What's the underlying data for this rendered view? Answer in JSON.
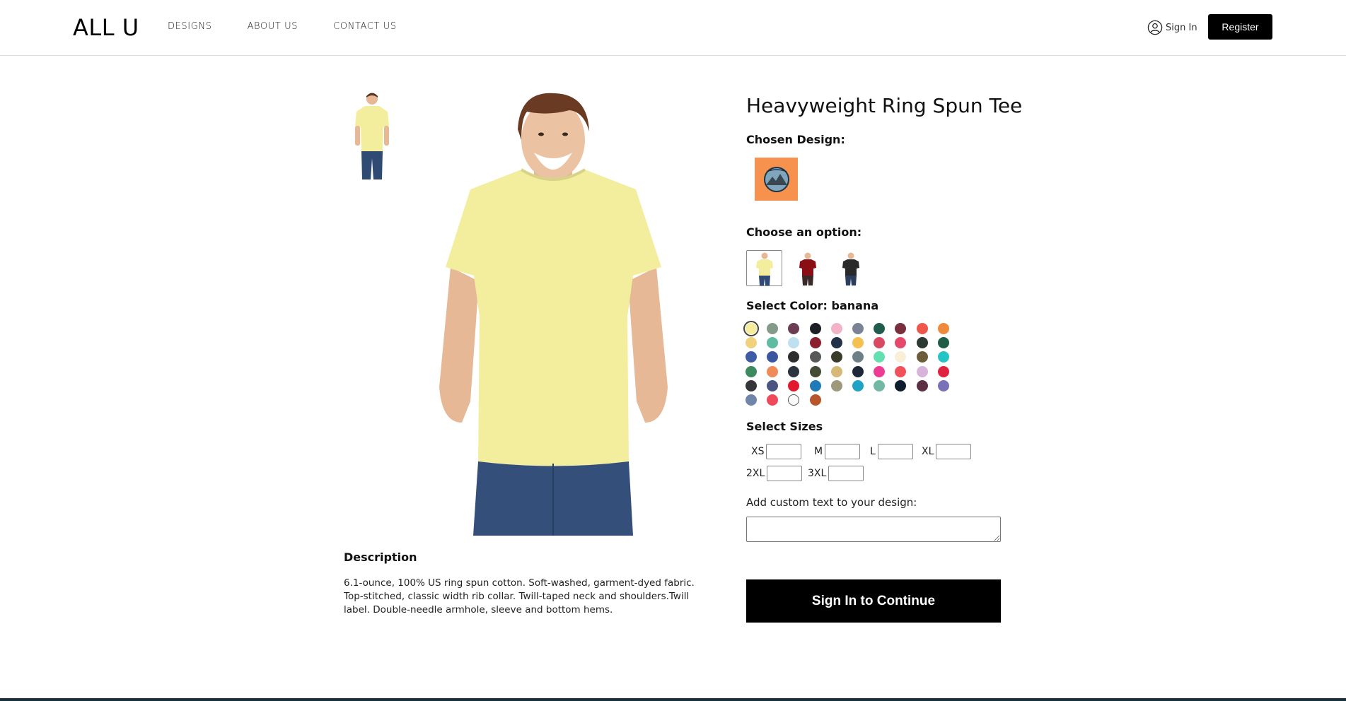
{
  "header": {
    "logo": "ALL U",
    "nav": [
      "DESIGNS",
      "ABOUT US",
      "CONTACT US"
    ],
    "sign_in": "Sign In",
    "register": "Register"
  },
  "product": {
    "title": "Heavyweight Ring Spun Tee",
    "chosen_design_label": "Chosen Design:",
    "choose_option_label": "Choose an option:",
    "select_color_label": "Select Color: banana",
    "select_sizes_label": "Select Sizes",
    "sizes": [
      "XS",
      "M",
      "L",
      "XL",
      "2XL",
      "3XL"
    ],
    "custom_text_label": "Add custom text to your design:",
    "cta": "Sign In to Continue",
    "description_title": "Description",
    "description": "6.1-ounce, 100% US ring spun cotton. Soft-washed, garment-dyed fabric. Top-stitched, classic width rib collar. Twill-taped neck and shoulders.Twill label. Double-needle armhole, sleeve and bottom hems.",
    "options": [
      {
        "name": "banana-tee-option",
        "color": "#f2ee9e",
        "pants": "#2f4a73",
        "selected": true
      },
      {
        "name": "red-hoodie-option",
        "color": "#8a0f14",
        "pants": "#3a2a2a",
        "selected": false
      },
      {
        "name": "black-tee-option",
        "color": "#2a2a2a",
        "pants": "#2d3d5c",
        "selected": false
      }
    ],
    "colors": [
      "#f5ec9c",
      "#859b8a",
      "#6c3d52",
      "#1c1f24",
      "#f3b3c6",
      "#7a8296",
      "#1f5c4e",
      "#7a2f3e",
      "#f0574c",
      "#f08a3a",
      "#f1d27c",
      "#5fbba4",
      "#bfe0ef",
      "#8c1f2f",
      "#243248",
      "#f4c052",
      "#d94a62",
      "#e4486b",
      "#2d3a33",
      "#1e5e46",
      "#3e5ba6",
      "#3a56a0",
      "#2d2d2d",
      "#56585a",
      "#3b3b2a",
      "#6f7f86",
      "#62e0b0",
      "#f9eed6",
      "#6b5c3b",
      "#25c4c4",
      "#3d8a5f",
      "#f08a58",
      "#2b3440",
      "#444c35",
      "#d6b877",
      "#1f2838",
      "#ec3c94",
      "#f0515a",
      "#d7b4d9",
      "#e1223f",
      "#34363a",
      "#4a5580",
      "#e2182f",
      "#1f7ab8",
      "#9e987c",
      "#20a2c4",
      "#73b8a4",
      "#0f1d2e",
      "#5d3143",
      "#7a72b8",
      "#6f86aa",
      "#ef4a5a",
      "#fafafa",
      "#b8552a"
    ],
    "selected_color": "banana"
  }
}
